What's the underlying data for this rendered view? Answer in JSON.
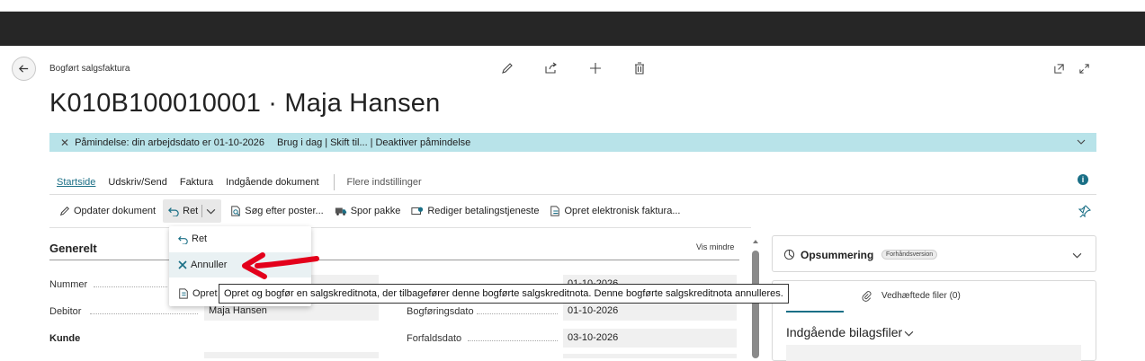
{
  "page": {
    "caption": "Bogført salgsfaktura",
    "title": "K010B100010001 · Maja Hansen"
  },
  "banner": {
    "message": "Påmindelse: din arbejdsdato er 01-10-2026",
    "link_today": "Brug i dag",
    "link_change": "Skift til...",
    "link_disable": "Deaktiver påmindelse",
    "sep": "|"
  },
  "tabs": {
    "items": [
      "Startside",
      "Udskriv/Send",
      "Faktura",
      "Indgående dokument"
    ],
    "more": "Flere indstillinger"
  },
  "toolbar": {
    "update_doc": "Opdater dokument",
    "ret": "Ret",
    "search_posts": "Søg efter poster...",
    "track_package": "Spor pakke",
    "edit_payment": "Rediger betalingstjeneste",
    "create_einvoice": "Opret elektronisk faktura..."
  },
  "dropdown": {
    "item_ret": "Ret",
    "item_annuller": "Annuller",
    "item_opret": "Opret"
  },
  "tooltip": "Opret og bogfør en salgskreditnota, der tilbagefører denne bogførte salgskreditnota. Denne bogførte salgskreditnota annulleres.",
  "general": {
    "section_title": "Generelt",
    "toggle": "Vis mindre",
    "fields": {
      "nummer_label": "Nummer",
      "debitor_label": "Debitor",
      "debitor_value": "Maja Hansen",
      "kunde_label": "Kunde",
      "bilagsdato_value": "01-10-2026",
      "bogf_label": "Bogføringsdato",
      "bogf_value": "01-10-2026",
      "forfald_label": "Forfaldsdato",
      "forfald_value": "03-10-2026"
    }
  },
  "factbox": {
    "summary_title": "Opsummering",
    "summary_badge": "Forhåndsversion",
    "attachments_tab": "Vedhæftede filer (0)",
    "incoming_title": "Indgående bilagsfiler"
  },
  "colors": {
    "banner_bg": "#b8e3e9",
    "accent": "#1a6f86",
    "top_bar": "#262626",
    "arrow": "#e3001b"
  }
}
